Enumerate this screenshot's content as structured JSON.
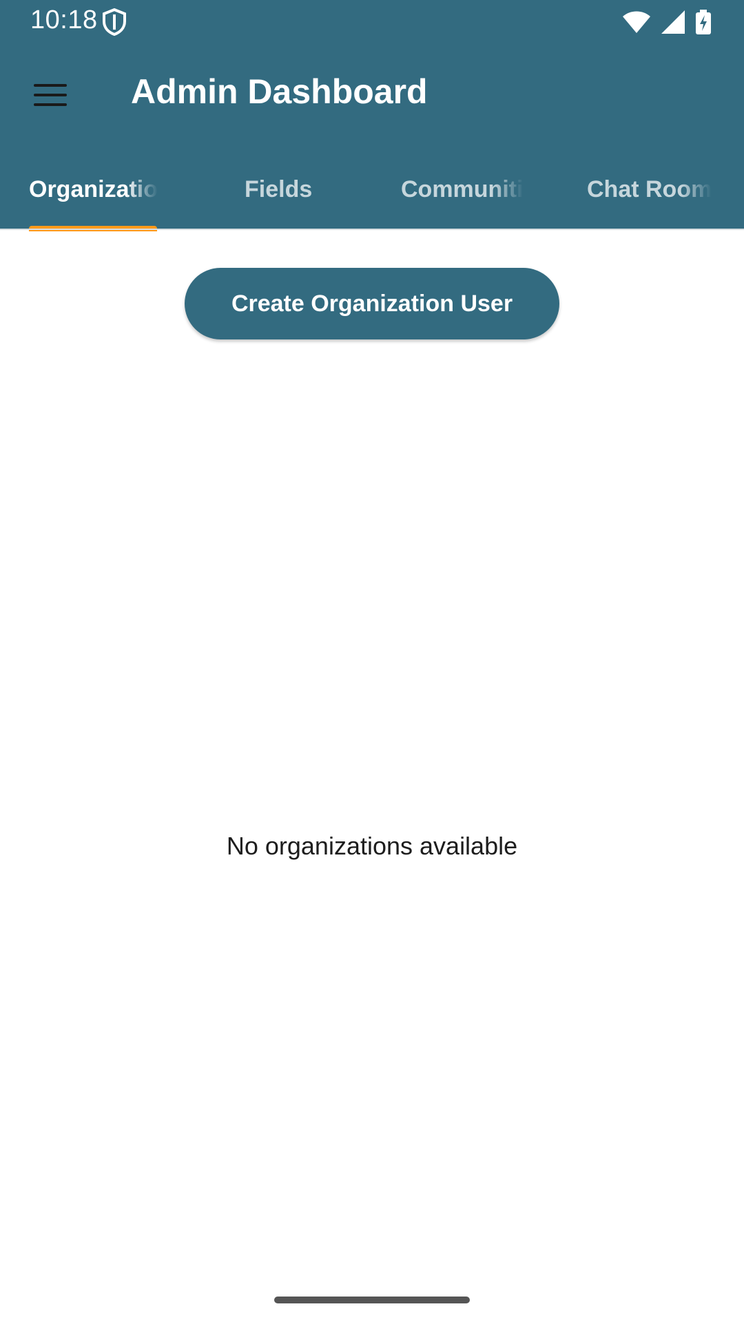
{
  "status_bar": {
    "time": "10:18",
    "icons": [
      "shield-icon",
      "wifi-icon",
      "cellular-signal-icon",
      "battery-charging-icon"
    ]
  },
  "app_bar": {
    "title": "Admin Dashboard",
    "menu_icon": "hamburger-menu-icon"
  },
  "tabs": [
    {
      "label": "Organizatio",
      "active": true
    },
    {
      "label": "Fields",
      "active": false
    },
    {
      "label": "Communiti",
      "active": false
    },
    {
      "label": "Chat Room",
      "active": false
    }
  ],
  "main": {
    "create_button_label": "Create Organization User",
    "empty_message": "No organizations available"
  },
  "colors": {
    "primary": "#336b80",
    "tab_indicator": "#ff9a1a",
    "background": "#ffffff"
  }
}
